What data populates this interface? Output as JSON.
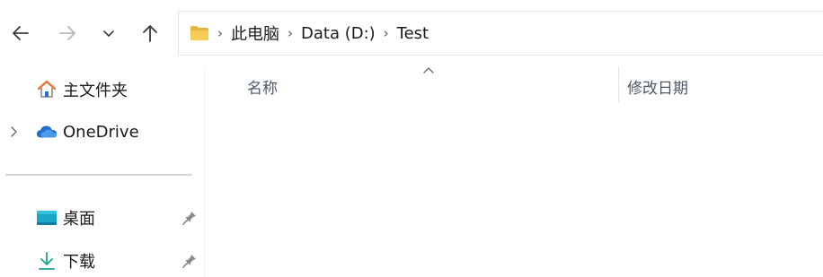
{
  "breadcrumb": [
    "此电脑",
    "Data (D:)",
    "Test"
  ],
  "sidebar": {
    "items": [
      {
        "label": "主文件夹",
        "icon": "home-icon"
      },
      {
        "label": "OneDrive",
        "icon": "onedrive-cloud-icon"
      },
      {
        "label": "桌面",
        "icon": "desktop-icon",
        "pinned": true
      },
      {
        "label": "下载",
        "icon": "download-icon",
        "pinned": true
      }
    ]
  },
  "columns": {
    "name": "名称",
    "date_modified": "修改日期"
  },
  "colors": {
    "folder": "#f5c84c",
    "onedrive": "#1f6fd1",
    "home_roof": "#e8743b",
    "desktop": "#19a6c9",
    "download": "#19a48f"
  }
}
